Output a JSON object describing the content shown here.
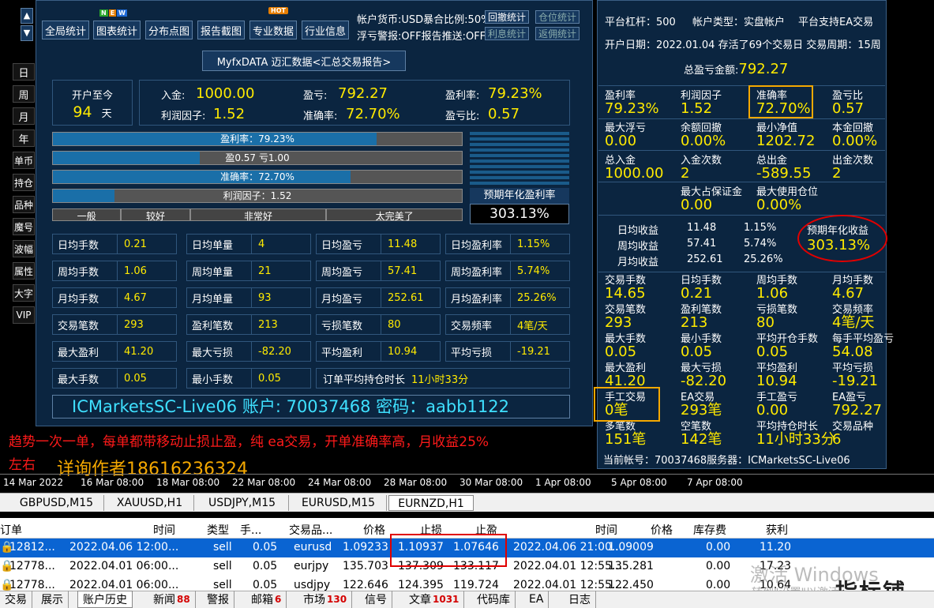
{
  "toolbar": {
    "buttons": [
      "全局统计",
      "图表统计",
      "分布点图",
      "报告截图",
      "专业数据",
      "行业信息"
    ],
    "new_badge": "NEW",
    "hot_badge": "HOT",
    "info1": "帐户货币:USD",
    "info1b": "暴合比例:50%",
    "info2": "浮亏警报:OFF",
    "info2b": "报告推送:OFF",
    "small_btns": [
      "回撤统计",
      "仓位统计",
      "利息统计",
      "返佣统计"
    ]
  },
  "report_title": "MyfxDATA 迈汇数据<汇总交易报告>",
  "summary": {
    "since_label": "开户至今",
    "days": "94",
    "days_unit": "天",
    "deposit_label": "入金:",
    "deposit": "1000.00",
    "pf_label": "利润因子:",
    "pf": "1.52",
    "profit_label": "盈亏:",
    "profit": "792.27",
    "acc_label": "准确率:",
    "acc": "72.70%",
    "roi_label": "盈利率:",
    "roi": "79.23%",
    "ratio_label": "盈亏比:",
    "ratio": "0.57"
  },
  "bars": {
    "b1": "盈利率：79.23%",
    "b2a": "盈0.57",
    "b2b": "亏1.00",
    "b3": "准确率：72.70%",
    "b4": "利润因子：1.52",
    "scale": [
      "一般",
      "较好",
      "非常好",
      "太完美了"
    ]
  },
  "annual": {
    "label": "预期年化盈利率",
    "value": "303.13%"
  },
  "stats": [
    [
      "日均手数",
      "0.21",
      "日均单量",
      "4",
      "日均盈亏",
      "11.48",
      "日均盈利率",
      "1.15%"
    ],
    [
      "周均手数",
      "1.06",
      "周均单量",
      "21",
      "周均盈亏",
      "57.41",
      "周均盈利率",
      "5.74%"
    ],
    [
      "月均手数",
      "4.67",
      "月均单量",
      "93",
      "月均盈亏",
      "252.61",
      "月均盈利率",
      "25.26%"
    ],
    [
      "交易笔数",
      "293",
      "盈利笔数",
      "213",
      "亏损笔数",
      "80",
      "交易频率",
      "4笔/天"
    ],
    [
      "最大盈利",
      "41.20",
      "最大亏损",
      "-82.20",
      "平均盈利",
      "10.94",
      "平均亏损",
      "-19.21"
    ],
    [
      "最大手数",
      "0.05",
      "最小手数",
      "0.05",
      "订单平均持仓时长",
      "11小时33分",
      "",
      ""
    ]
  ],
  "account_line": "ICMarketsSC-Live06 账户: 70037468  密码：aabb1122",
  "promo": {
    "line1": "趋势一次一单，每单都带移动止损止盈，纯 ea交易，开单准确率高，月收益25%",
    "line2": "左右",
    "line3": "详询作者18616236324"
  },
  "left_tabs": [
    "日",
    "周",
    "月",
    "年",
    "单币",
    "持仓",
    "品种",
    "魔号",
    "波幅",
    "属性",
    "大字",
    "VIP"
  ],
  "right": {
    "leverage": "平台杠杆：500",
    "acctype": "帐户类型：实盘帐户",
    "ea": "平台支持EA交易",
    "opendate": "开户日期：2022.01.04  存活了69个交易日  交易周期：15周",
    "total_label": "总盈亏金额:",
    "total": "792.27",
    "grid1": [
      [
        "盈利率",
        "79.23%"
      ],
      [
        "利润因子",
        "1.52"
      ],
      [
        "准确率",
        "72.70%"
      ],
      [
        "盈亏比",
        "0.57"
      ],
      [
        "最大浮亏",
        "0.00"
      ],
      [
        "余额回撤",
        "0.00%"
      ],
      [
        "最小净值",
        "1202.72"
      ],
      [
        "本金回撤",
        "0.00%"
      ],
      [
        "总入金",
        "1000.00"
      ],
      [
        "入金次数",
        "2"
      ],
      [
        "总出金",
        "-589.55"
      ],
      [
        "出金次数",
        "2"
      ],
      [
        "",
        ""
      ],
      [
        "最大占保证金",
        "0.00"
      ],
      [
        "最大使用仓位",
        "0.00%"
      ],
      [
        "",
        ""
      ]
    ],
    "returns": [
      [
        "日均收益",
        "11.48",
        "1.15%"
      ],
      [
        "周均收益",
        "57.41",
        "5.74%"
      ],
      [
        "月均收益",
        "252.61",
        "25.26%"
      ]
    ],
    "annual_label": "预期年化收益",
    "annual": "303.13%",
    "grid2": [
      [
        "交易手数",
        "14.65"
      ],
      [
        "日均手数",
        "0.21"
      ],
      [
        "周均手数",
        "1.06"
      ],
      [
        "月均手数",
        "4.67"
      ],
      [
        "交易笔数",
        "293"
      ],
      [
        "盈利笔数",
        "213"
      ],
      [
        "亏损笔数",
        "80"
      ],
      [
        "交易频率",
        "4笔/天"
      ],
      [
        "最大手数",
        "0.05"
      ],
      [
        "最小手数",
        "0.05"
      ],
      [
        "平均开仓手数",
        "0.05"
      ],
      [
        "每手平均盈亏",
        "54.08"
      ],
      [
        "最大盈利",
        "41.20"
      ],
      [
        "最大亏损",
        "-82.20"
      ],
      [
        "平均盈利",
        "10.94"
      ],
      [
        "平均亏损",
        "-19.21"
      ],
      [
        "手工交易",
        "0笔"
      ],
      [
        "EA交易",
        "293笔"
      ],
      [
        "手工盈亏",
        "0.00"
      ],
      [
        "EA盈亏",
        "792.27"
      ],
      [
        "多笔数",
        "151笔"
      ],
      [
        "空笔数",
        "142笔"
      ],
      [
        "平均持仓时长",
        "11小时33分"
      ],
      [
        "交易品种",
        "6"
      ]
    ],
    "footer": "当前帐号：70037468服务器：ICMarketsSC-Live06"
  },
  "timeaxis": [
    "14 Mar 2022",
    "16 Mar 08:00",
    "18 Mar 08:00",
    "22 Mar 08:00",
    "24 Mar 08:00",
    "28 Mar 08:00",
    "30 Mar 08:00",
    "1 Apr 08:00",
    "5 Apr 08:00",
    "7 Apr 08:00"
  ],
  "chart_tabs": [
    "GBPUSD,M15",
    "XAUUSD,H1",
    "USDJPY,M15",
    "EURUSD,M15",
    "EURNZD,H1"
  ],
  "table": {
    "headers": [
      "订单",
      "时间",
      "类型",
      "手...",
      "交易品...",
      "价格",
      "止损",
      "止盈",
      "时间",
      "价格",
      "库存费",
      "获利"
    ],
    "rows": [
      [
        "12812...",
        "2022.04.06 12:00...",
        "sell",
        "0.05",
        "eurusd",
        "1.09233",
        "1.10937",
        "1.07646",
        "2022.04.06 21:00...",
        "1.09009",
        "0.00",
        "11.20"
      ],
      [
        "12778...",
        "2022.04.01 06:00...",
        "sell",
        "0.05",
        "eurjpy",
        "135.703",
        "137.309",
        "133.117",
        "2022.04.01 12:55...",
        "135.281",
        "0.00",
        "17.23"
      ],
      [
        "12778...",
        "2022.04.01 06:00...",
        "sell",
        "0.05",
        "usdjpy",
        "122.646",
        "124.395",
        "119.724",
        "2022.04.01 12:55...",
        "122.450",
        "0.00",
        "10.64"
      ]
    ]
  },
  "bottom_tabs": [
    [
      "交易",
      ""
    ],
    [
      "展示",
      ""
    ],
    [
      "账户历史",
      ""
    ],
    [
      "新闻",
      "88"
    ],
    [
      "警报",
      ""
    ],
    [
      "邮箱",
      "6"
    ],
    [
      "市场",
      "130"
    ],
    [
      "信号",
      ""
    ],
    [
      "文章",
      "1031"
    ],
    [
      "代码库",
      ""
    ],
    [
      "EA",
      ""
    ],
    [
      "日志",
      ""
    ]
  ],
  "watermark": "激活 Windows",
  "watermark2": "转到\"设置\"以激活",
  "logo": "指标铺",
  "colors": {
    "panel": "#0b2540",
    "yellow": "#ffea00",
    "red": "#e00000",
    "orange": "#f5a800",
    "select": "#0a64d2"
  }
}
